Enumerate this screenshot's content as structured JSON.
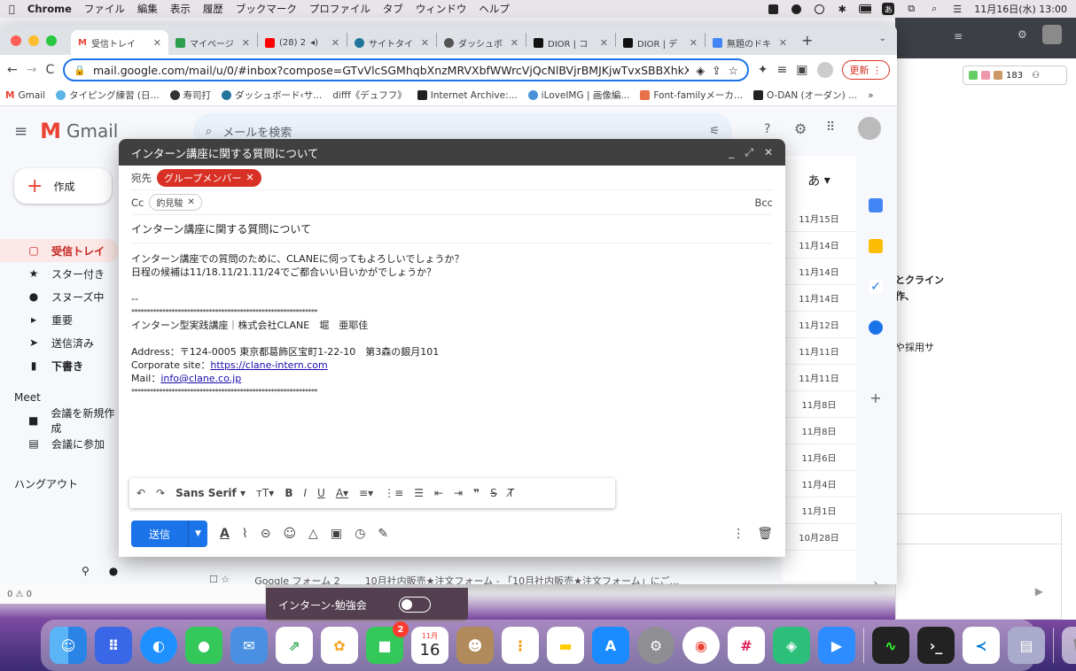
{
  "menubar": {
    "app": "Chrome",
    "items": [
      "ファイル",
      "編集",
      "表示",
      "履歴",
      "ブックマーク",
      "プロファイル",
      "タブ",
      "ウィンドウ",
      "ヘルプ"
    ],
    "datetime": "11月16日(水) 13:00"
  },
  "tabs": [
    {
      "label": "受信トレイ",
      "active": true
    },
    {
      "label": "マイページ"
    },
    {
      "label": "(28) 2"
    },
    {
      "label": "サイトタイ"
    },
    {
      "label": "ダッシュボ"
    },
    {
      "label": "DIOR | コ"
    },
    {
      "label": "DIOR | デ"
    },
    {
      "label": "無題のドキ"
    }
  ],
  "toolbar": {
    "url": "mail.google.com/mail/u/0/#inbox?compose=GTvVlcSGMhqbXnzMRVXbfWWrcVjQcNlBVjrBMJKjwTvxSBBXhkXk...",
    "update_label": "更新"
  },
  "bookmarks": [
    "Gmail",
    "タイピング練習 (日...",
    "寿司打",
    "ダッシュボード‹サ...",
    "difff《デュフフ》",
    "Internet Archive:...",
    "iLoveIMG | 画像編...",
    "Font-familyメーカ...",
    "O-DAN (オーダン) ..."
  ],
  "gmail": {
    "logo": "Gmail",
    "search_placeholder": "メールを検索",
    "compose_label": "作成",
    "nav": [
      "受信トレイ",
      "スター付き",
      "スヌーズ中",
      "重要",
      "送信済み",
      "下書き"
    ],
    "meet_title": "Meet",
    "meet_items": [
      "会議を新規作成",
      "会議に参加"
    ],
    "hangouts": "ハングアウト",
    "dates": [
      "11月15日",
      "11月14日",
      "11月14日",
      "11月14日",
      "11月12日",
      "11月11日",
      "11月11日",
      "11月8日",
      "11月8日",
      "11月6日",
      "11月4日",
      "11月1日",
      "10月28日"
    ],
    "lang_icon": "あ",
    "last_row_sender": "Google フォーム 2",
    "last_row_subject": "10月社内販売★注文フォーム - 「10月社内販売★注文フォーム」にご..."
  },
  "compose": {
    "title": "インターン講座に関する質問について",
    "to_label": "宛先",
    "to_chip": "グループメンバー",
    "cc_label": "Cc",
    "cc_chip": "釣見駿",
    "bcc": "Bcc",
    "subject": "インターン講座に関する質問について",
    "body_line1": "インターン講座での質問のために、CLANEに伺ってもよろしいでしょうか？",
    "body_line2": "日程の候補は11/18.11/21.11/24でご都合いい日いかがでしょうか？",
    "sig_dash": "--",
    "sig_stars": "************************************************************",
    "sig_name": "インターン型実践講座｜株式会社CLANE　堀　亜耶佳",
    "sig_address": "Address：〒124-0005 東京都葛飾区宝町1-22-10　第3森の銀月101",
    "sig_corp_label": "Corporate site：",
    "sig_corp_link": "https://clane-intern.com",
    "sig_mail_label": "Mail：",
    "sig_mail_link": "info@clane.co.jp",
    "font": "Sans Serif",
    "send_label": "送信"
  },
  "chat": {
    "label": "インターン-勉強会"
  },
  "statusbar": "0 ⚠ 0",
  "rightwin": {
    "count": "183",
    "partial1": "とクライン",
    "partial2": "作、",
    "partial3": "や採用サ"
  },
  "dock": {
    "calendar_month": "11月",
    "calendar_day": "16",
    "facetime_badge": "2"
  }
}
